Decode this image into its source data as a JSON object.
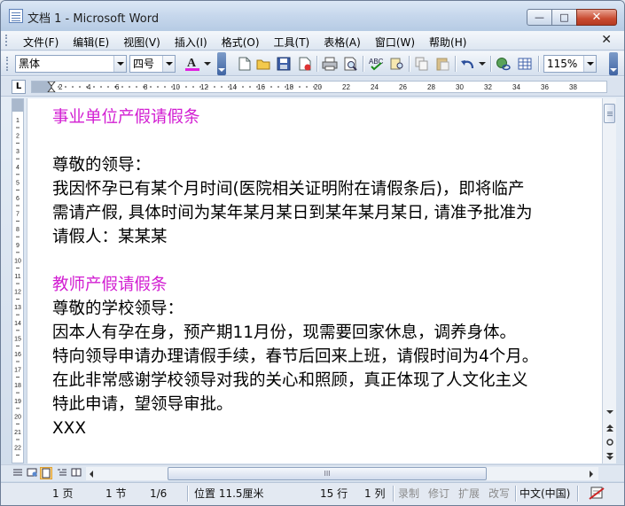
{
  "window": {
    "title": "文档 1 - Microsoft Word",
    "minimize": "—",
    "maximize": "□",
    "close": "✕"
  },
  "menu": {
    "items": [
      "文件(F)",
      "编辑(E)",
      "视图(V)",
      "插入(I)",
      "格式(O)",
      "工具(T)",
      "表格(A)",
      "窗口(W)",
      "帮助(H)"
    ],
    "close": "✕"
  },
  "toolbar": {
    "font": "黑体",
    "size": "四号",
    "font_color_letter": "A",
    "font_color": "#e020e0",
    "zoom": "115%"
  },
  "ruler": {
    "tab_marker": "L",
    "numbers": [
      "2",
      "4",
      "6",
      "8",
      "10",
      "12",
      "14",
      "16",
      "18",
      "20",
      "22",
      "24",
      "26",
      "28",
      "30",
      "32",
      "34",
      "36",
      "38"
    ],
    "v_numbers": [
      "1",
      "2",
      "3",
      "4",
      "5",
      "6",
      "7",
      "8",
      "9",
      "10",
      "11",
      "12",
      "13",
      "14",
      "15",
      "16",
      "17",
      "18",
      "19",
      "20",
      "21",
      "22"
    ]
  },
  "document": {
    "title1": "事业单位产假请假条",
    "greeting1": "尊敬的领导：",
    "line1": "我因怀孕已有某个月时间(医院相关证明附在请假条后)，即将临产",
    "line2": "需请产假, 具体时间为某年某月某日到某年某月某日, 请准予批准为",
    "line3": "请假人：某某某",
    "title2": "教师产假请假条",
    "greeting2": "尊敬的学校领导：",
    "line4": "因本人有孕在身，预产期11月份，现需要回家休息，调养身体。",
    "line5": "特向领导申请办理请假手续，春节后回来上班，请假时间为4个月。",
    "line6": "在此非常感谢学校领导对我的关心和照顾，真正体现了人文化主义",
    "line7": "特此申请，望领导审批。",
    "line8": "XXX",
    "title_color": "#d21ed2"
  },
  "hscroll_grip": "III",
  "status": {
    "page": "1 页",
    "section": "1 节",
    "pages": "1/6",
    "position": "位置 11.5厘米",
    "row": "15 行",
    "col": "1 列",
    "rec": "录制",
    "trk": "修订",
    "ext": "扩展",
    "ovr": "改写",
    "lang": "中文(中国)"
  }
}
